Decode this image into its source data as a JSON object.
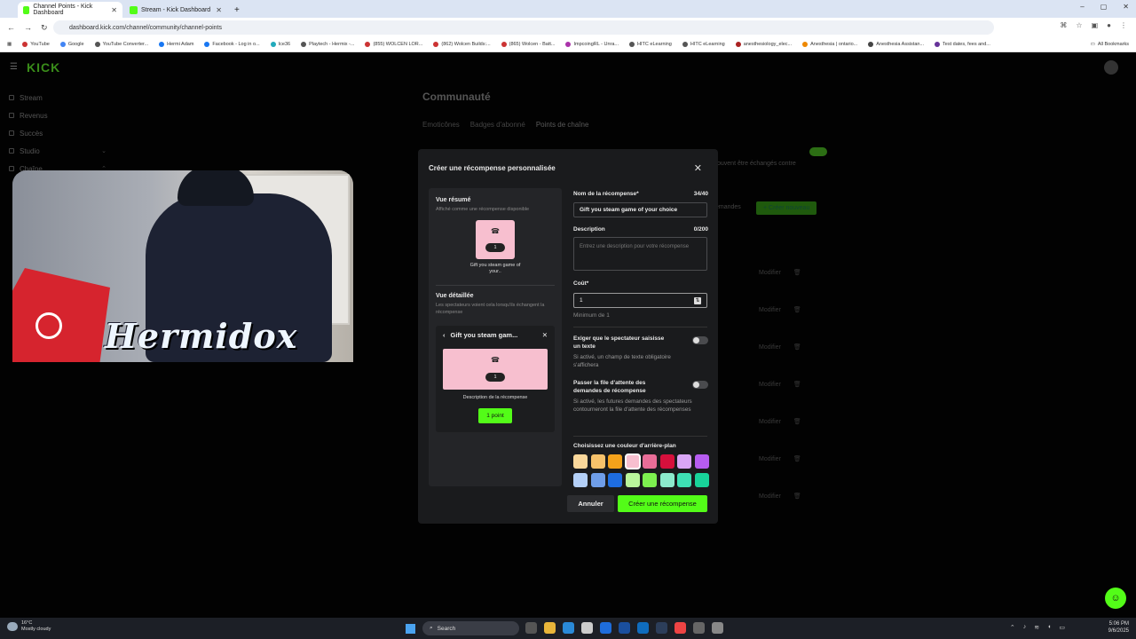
{
  "browser": {
    "tabs": [
      {
        "title": "Channel Points - Kick Dashboard"
      },
      {
        "title": "Stream - Kick Dashboard"
      }
    ],
    "url": "dashboard.kick.com/channel/community/channel-points",
    "bookmarks": [
      "YouTube",
      "Google",
      "YouTube Converter...",
      "Hermi Adam",
      "Facebook - Log in o...",
      "Ice36",
      "Playtech - Hermix -...",
      "(855) WOLCEN LOR...",
      "(862) Wolcen Builds:...",
      "(865) Wolcen - Batt...",
      "ImpcoingRL - Unra...",
      "HITC eLearning",
      "HITC eLearning",
      "anesthesiology_elec...",
      "Anesthesia | ontario...",
      "Anesthesia Assistan...",
      "Test dates, fees and..."
    ],
    "all_bookmarks": "All Bookmarks"
  },
  "sidebar": {
    "items": [
      {
        "label": "Stream"
      },
      {
        "label": "Revenus"
      },
      {
        "label": "Succès"
      },
      {
        "label": "Studio"
      },
      {
        "label": "Chaîne"
      }
    ]
  },
  "background": {
    "title": "Communauté",
    "tabs": [
      "Emoticônes",
      "Badges d'abonné",
      "Points de chaîne"
    ],
    "note": "ouvent être échangés contre",
    "demandes": "emandes",
    "create_new": "+ Créer nouveau",
    "row_action": "Modifier"
  },
  "webcam": {
    "name": "Hermidox"
  },
  "modal": {
    "title": "Créer une récompense personnalisée",
    "preview": {
      "summary_title": "Vue résumé",
      "summary_sub": "Affiché comme une récompense disponible",
      "card_count": "1",
      "card_label": "Gift you steam game of your..",
      "detail_title": "Vue détaillée",
      "detail_sub": "Les spectateurs voient cela lorsqu'ils échangent la récompense",
      "detail_name": "Gift you steam gam...",
      "detail_desc": "Description de la récompense",
      "detail_button": "1 point"
    },
    "form": {
      "name_label": "Nom de la récompense*",
      "name_count": "34/40",
      "name_value": "Gift you steam game of your choice",
      "desc_label": "Description",
      "desc_count": "0/200",
      "desc_placeholder": "Entrez une description pour votre récompense",
      "cost_label": "Coût*",
      "cost_value": "1",
      "cost_hint": "Minimum de 1",
      "toggle1_title": "Exiger que le spectateur saisisse un texte",
      "toggle1_desc": "Si activé, un champ de texte obligatoire s'affichera",
      "toggle2_title": "Passer la file d'attente des demandes de récompense",
      "toggle2_desc": "Si activé, les futures demandes des spectateurs contourneront la file d'attente des récompenses",
      "color_title": "Choisissez une couleur d'arrière-plan",
      "colors": [
        "#f9d79a",
        "#f7c26b",
        "#f4a21b",
        "#f7bfcf",
        "#e86d97",
        "#d6103c",
        "#d9a6f5",
        "#b65cf0",
        "#b3cff7",
        "#6f9ee9",
        "#1e6de0",
        "#b9f59b",
        "#7df04f",
        "#8ceacc",
        "#3ee0b4",
        "#18d49a"
      ],
      "selected_color_index": 3
    },
    "cancel": "Annuler",
    "create": "Créer une récompense"
  },
  "taskbar": {
    "temp": "16°C",
    "weather": "Mostly cloudy",
    "search": "Search",
    "time": "5:06 PM",
    "date": "9/6/2025"
  }
}
